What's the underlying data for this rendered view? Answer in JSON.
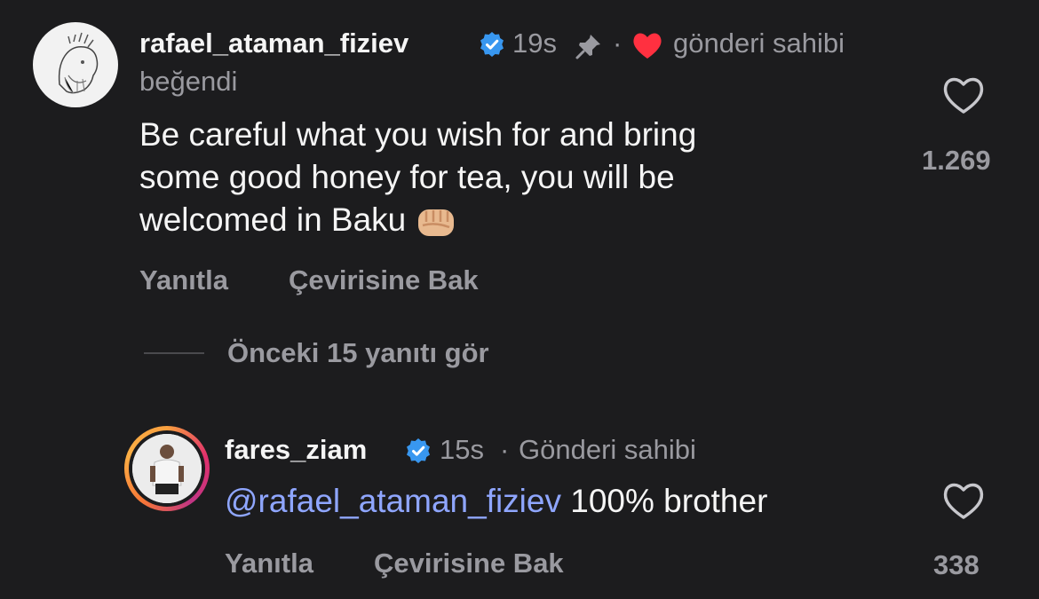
{
  "comment": {
    "username": "rafael_ataman_fiziev",
    "time": "19s",
    "separator": "·",
    "liked_by_owner": "gönderi sahibi",
    "liked_label": "beğendi",
    "text_line1": "Be careful what you wish for and bring",
    "text_line2": "some good honey for tea, you will be",
    "text_line3": "welcomed in Baku",
    "reply_label": "Yanıtla",
    "translate_label": "Çevirisine Bak",
    "like_count": "1.269"
  },
  "view_replies": "Önceki 15 yanıtı gör",
  "reply": {
    "username": "fares_ziam",
    "time": "15s",
    "separator": "·",
    "owner_label": "Gönderi sahibi",
    "mention": "@rafael_ataman_fiziev",
    "text": "100% brother",
    "reply_label": "Yanıtla",
    "translate_label": "Çevirisine Bak",
    "like_count": "338"
  },
  "colors": {
    "background": "#1c1c1e",
    "verified": "#3897f0",
    "heart_red": "#ff3040",
    "mention": "#8fa6ff"
  }
}
